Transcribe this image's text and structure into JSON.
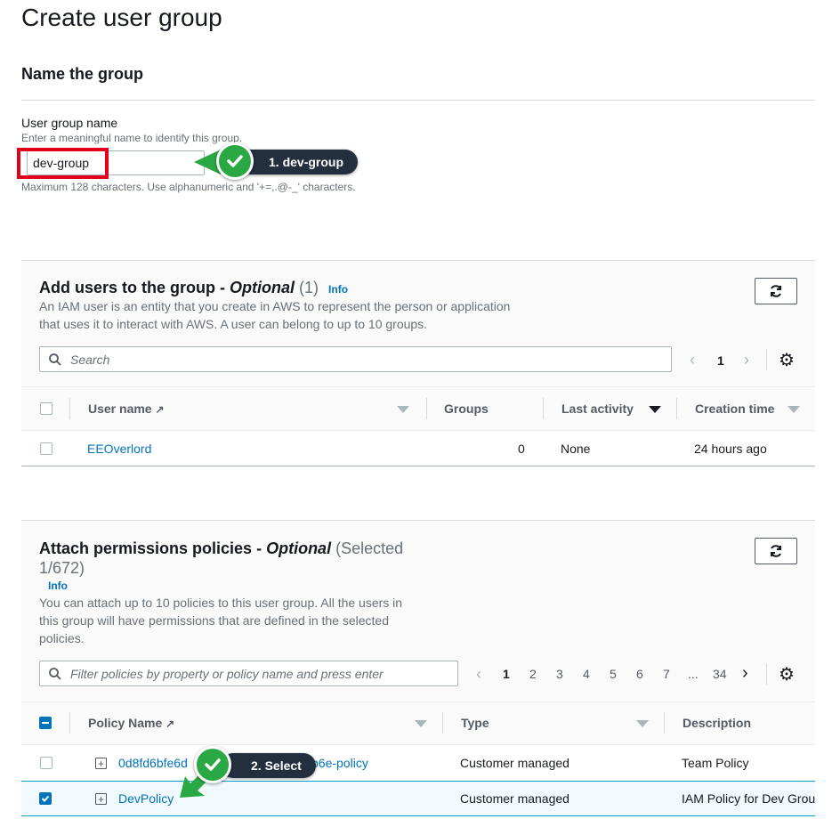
{
  "page": {
    "title": "Create user group"
  },
  "name_section": {
    "title": "Name the group",
    "field_label": "User group name",
    "field_description": "Enter a meaningful name to identify this group.",
    "field_value": "dev-group",
    "constraint": "Maximum 128 characters. Use alphanumeric and '+=,.@-_' characters."
  },
  "annotations": {
    "step1": "1. dev-group",
    "step2": "2. Select",
    "color": "#2aa843"
  },
  "users_panel": {
    "title": "Add users to the group - ",
    "title_italic": "Optional",
    "count": "(1)",
    "info": "Info",
    "description": "An IAM user is an entity that you create in AWS to represent the person or application that uses it to interact with AWS. A user can belong to up to 10 groups.",
    "search_placeholder": "Search",
    "page": "1",
    "columns": [
      "User name",
      "Groups",
      "Last activity",
      "Creation time"
    ],
    "rows": [
      {
        "user_name": "EEOverlord",
        "groups": "0",
        "last_activity": "None",
        "creation_time": "24 hours ago"
      }
    ]
  },
  "policies_panel": {
    "title": "Attach permissions policies - ",
    "title_italic": "Optional",
    "count_line1": "(Selected",
    "count_line2": "1/672)",
    "info": "Info",
    "description": "You can attach up to 10 policies to this user group. All the users in this group will have permissions that are defined in the selected policies.",
    "search_placeholder": "Filter policies by property or policy name and press enter",
    "pages": [
      "1",
      "2",
      "3",
      "4",
      "5",
      "6",
      "7",
      "...",
      "34"
    ],
    "columns": [
      "Policy Name",
      "Type",
      "Description"
    ],
    "rows": [
      {
        "name_start": "0d8fd6bfe6d",
        "name_end": "b6e-policy",
        "type": "Customer managed",
        "description": "Team Policy",
        "selected": false
      },
      {
        "name": "DevPolicy",
        "type": "Customer managed",
        "description": "IAM Policy for Dev Grou",
        "selected": true
      }
    ]
  },
  "colors": {
    "link": "#0073bb",
    "highlight": "#e3001b",
    "callout": "#232f3e"
  }
}
